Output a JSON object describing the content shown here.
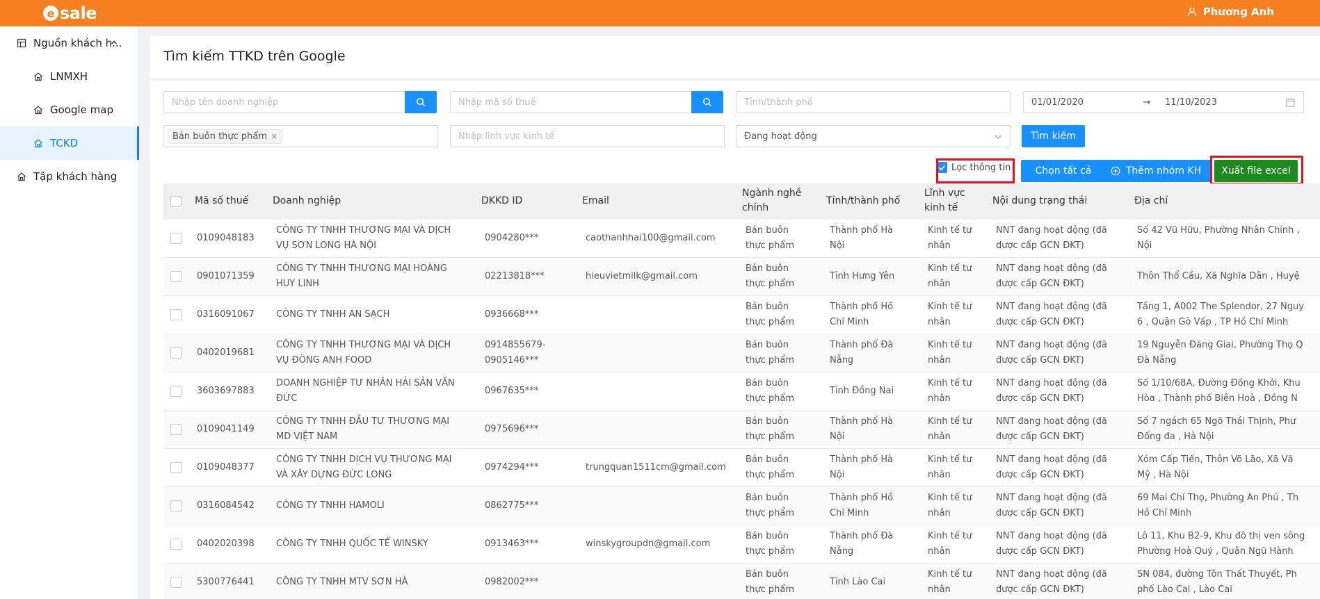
{
  "header": {
    "logo_letter": "e",
    "logo_text": "sale",
    "user_name": "Phương Anh"
  },
  "sidebar": {
    "group_label": "Nguồn khách h...",
    "items": [
      {
        "label": "LNMXH"
      },
      {
        "label": "Google map"
      },
      {
        "label": "TCKD"
      }
    ],
    "group2_label": "Tập khách hàng"
  },
  "page": {
    "title": "Tìm kiếm TTKD trên Google"
  },
  "filters": {
    "company_placeholder": "Nhập tên doanh nghiệp",
    "tax_placeholder": "Nhập mã số thuế",
    "province_placeholder": "Tỉnh/thành phố",
    "date_from": "01/01/2020",
    "date_arrow": "→",
    "date_to": "11/10/2023",
    "tag_value": "Bán buôn thực phẩm",
    "tag_close": "×",
    "sector_placeholder": "Nhập lĩnh vực kinh tế",
    "status_value": "Đang hoạt động",
    "search_button": "Tìm kiếm",
    "filter_checkbox_label": "Lọc thông tin",
    "select_all_button": "Chọn tất cả",
    "add_group_button": "Thêm nhóm KH",
    "export_button": "Xuất file excel"
  },
  "table": {
    "headers": {
      "tax": "Mã số thuế",
      "company": "Doanh nghiệp",
      "dkkd": "DKKD ID",
      "email": "Email",
      "industry_1": "Ngành nghề",
      "industry_2": "chính",
      "province": "Tỉnh/thành phố",
      "sector_1": "Lĩnh vực",
      "sector_2": "kinh tế",
      "status": "Nội dung trạng thái",
      "address": "Địa chỉ"
    },
    "rows": [
      {
        "tax": "0109048183",
        "company_1": "CÔNG TY TNHH THƯƠNG MẠI VÀ DỊCH",
        "company_2": "VỤ SƠN LONG HÀ NỘI",
        "dkkd_1": "0904280***",
        "dkkd_2": "",
        "email": "caothanhhai100@gmail.com",
        "industry_1": "Bán buôn",
        "industry_2": "thực phẩm",
        "province_1": "Thành phố Hà",
        "province_2": "Nội",
        "sector_1": "Kinh tế tư",
        "sector_2": "nhân",
        "status_1": "NNT đang hoạt động (đã",
        "status_2": "được cấp GCN ĐKT)",
        "address_1": "Số 42 Vũ Hữu, Phường Nhân Chính ,",
        "address_2": "Nội"
      },
      {
        "tax": "0901071359",
        "company_1": "CÔNG TY TNHH THƯƠNG MẠI HOÀNG",
        "company_2": "HUY LINH",
        "dkkd_1": "02213818***",
        "dkkd_2": "",
        "email": "hieuvietmilk@gmail.com",
        "industry_1": "Bán buôn",
        "industry_2": "thực phẩm",
        "province_1": "Tỉnh Hưng Yên",
        "province_2": "",
        "sector_1": "Kinh tế tư",
        "sector_2": "nhân",
        "status_1": "NNT đang hoạt động (đã",
        "status_2": "được cấp GCN ĐKT)",
        "address_1": "Thôn Thổ Cầu, Xã Nghĩa Dân , Huyệ",
        "address_2": ""
      },
      {
        "tax": "0316091067",
        "company_1": "CÔNG TY TNHH AN SẠCH",
        "company_2": "",
        "dkkd_1": "0936668***",
        "dkkd_2": "",
        "email": "",
        "industry_1": "Bán buôn",
        "industry_2": "thực phẩm",
        "province_1": "Thành phố Hồ",
        "province_2": "Chí Minh",
        "sector_1": "Kinh tế tư",
        "sector_2": "nhân",
        "status_1": "NNT đang hoạt động (đã",
        "status_2": "được cấp GCN ĐKT)",
        "address_1": "Tầng 1, A002 The Splendor, 27 Nguy",
        "address_2": "6 , Quận Gò Vấp , TP Hồ Chí Minh"
      },
      {
        "tax": "0402019681",
        "company_1": "CÔNG TY TNHH THƯƠNG MẠI VÀ DỊCH",
        "company_2": "VỤ ĐÔNG ANH FOOD",
        "dkkd_1": "0914855679-",
        "dkkd_2": "0905146***",
        "email": "",
        "industry_1": "Bán buôn",
        "industry_2": "thực phẩm",
        "province_1": "Thành phố Đà",
        "province_2": "Nẵng",
        "sector_1": "Kinh tế tư",
        "sector_2": "nhân",
        "status_1": "NNT đang hoạt động (đã",
        "status_2": "được cấp GCN ĐKT)",
        "address_1": "19 Nguyễn Đăng Giai, Phường Thọ Q",
        "address_2": "Đà Nẵng"
      },
      {
        "tax": "3603697883",
        "company_1": "DOANH NGHIỆP TƯ NHÂN HẢI SẢN VĂN",
        "company_2": "ĐỨC",
        "dkkd_1": "0967635***",
        "dkkd_2": "",
        "email": "",
        "industry_1": "Bán buôn",
        "industry_2": "thực phẩm",
        "province_1": "Tỉnh Đồng Nai",
        "province_2": "",
        "sector_1": "Kinh tế tư",
        "sector_2": "nhân",
        "status_1": "NNT đang hoạt động (đã",
        "status_2": "được cấp GCN ĐKT)",
        "address_1": "Số 1/10/68A, Đường Đồng Khởi, Khu",
        "address_2": "Hòa , Thành phố Biên Hoà , Đồng N"
      },
      {
        "tax": "0109041149",
        "company_1": "CÔNG TY TNHH ĐẦU TƯ THƯƠNG MẠI",
        "company_2": "MD VIỆT NAM",
        "dkkd_1": "0975696***",
        "dkkd_2": "",
        "email": "",
        "industry_1": "Bán buôn",
        "industry_2": "thực phẩm",
        "province_1": "Thành phố Hà",
        "province_2": "Nội",
        "sector_1": "Kinh tế tư",
        "sector_2": "nhân",
        "status_1": "NNT đang hoạt động (đã",
        "status_2": "được cấp GCN ĐKT)",
        "address_1": "Số 7 ngách 65 Ngõ Thái Thịnh, Phư",
        "address_2": "Đống đa , Hà Nội"
      },
      {
        "tax": "0109048377",
        "company_1": "CÔNG TY TNHH DỊCH VỤ THƯƠNG MẠI",
        "company_2": "VÀ XÂY DỰNG ĐỨC LONG",
        "dkkd_1": "0974294***",
        "dkkd_2": "",
        "email": "trungquan1511cm@gmail.com",
        "industry_1": "Bán buôn",
        "industry_2": "thực phẩm",
        "province_1": "Thành phố Hà",
        "province_2": "Nội",
        "sector_1": "Kinh tế tư",
        "sector_2": "nhân",
        "status_1": "NNT đang hoạt động (đã",
        "status_2": "được cấp GCN ĐKT)",
        "address_1": "Xóm Cấp Tiến, Thôn Võ Lão, Xã Vă",
        "address_2": "Mỹ , Hà Nội"
      },
      {
        "tax": "0316084542",
        "company_1": "CÔNG TY TNHH HAMOLI",
        "company_2": "",
        "dkkd_1": "0862775***",
        "dkkd_2": "",
        "email": "",
        "industry_1": "Bán buôn",
        "industry_2": "thực phẩm",
        "province_1": "Thành phố Hồ",
        "province_2": "Chí Minh",
        "sector_1": "Kinh tế tư",
        "sector_2": "nhân",
        "status_1": "NNT đang hoạt động (đã",
        "status_2": "được cấp GCN ĐKT)",
        "address_1": "69 Mai Chí Thọ, Phường An Phú , Th",
        "address_2": "Hồ Chí Minh"
      },
      {
        "tax": "0402020398",
        "company_1": "CÔNG TY TNHH QUỐC TẾ WINSKY",
        "company_2": "",
        "dkkd_1": "0913463***",
        "dkkd_2": "",
        "email": "winskygroupdn@gmail.com",
        "industry_1": "Bán buôn",
        "industry_2": "thực phẩm",
        "province_1": "Thành phố Đà",
        "province_2": "Nẵng",
        "sector_1": "Kinh tế tư",
        "sector_2": "nhân",
        "status_1": "NNT đang hoạt động (đã",
        "status_2": "được cấp GCN ĐKT)",
        "address_1": "Lô 11, Khu B2-9, Khu đô thị ven sông",
        "address_2": "Phường Hoà Quý , Quận Ngũ Hành"
      },
      {
        "tax": "5300776441",
        "company_1": "CÔNG TY TNHH MTV SƠN HÀ",
        "company_2": "",
        "dkkd_1": "0982002***",
        "dkkd_2": "",
        "email": "",
        "industry_1": "Bán buôn",
        "industry_2": "thực phẩm",
        "province_1": "Tỉnh Lào Cai",
        "province_2": "",
        "sector_1": "Kinh tế tư",
        "sector_2": "nhân",
        "status_1": "NNT đang hoạt động (đã",
        "status_2": "được cấp GCN ĐKT)",
        "address_1": "SN 084, đường Tôn Thất Thuyết, Ph",
        "address_2": "phố Lào Cai , Lào Cai"
      }
    ]
  },
  "colors": {
    "brand": "#f6801f",
    "primary": "#1890ff",
    "export": "#1c8a1c",
    "highlight": "#e8101a"
  }
}
